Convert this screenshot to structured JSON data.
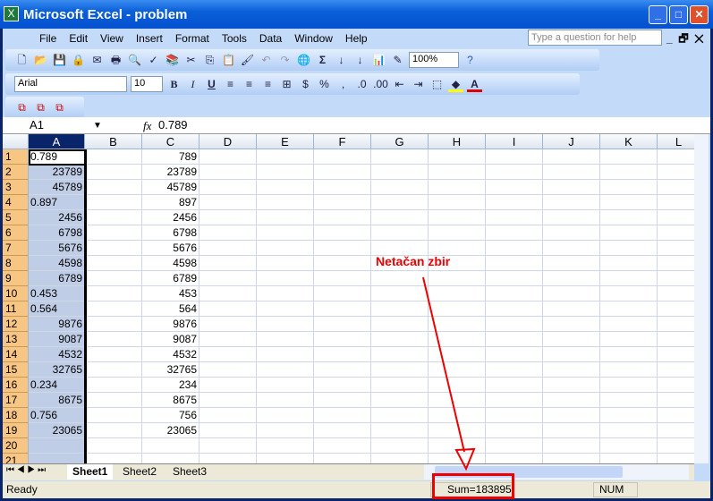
{
  "window": {
    "title": "Microsoft Excel - problem"
  },
  "menu": [
    "File",
    "Edit",
    "View",
    "Insert",
    "Format",
    "Tools",
    "Data",
    "Window",
    "Help"
  ],
  "help_placeholder": "Type a question for help",
  "toolbar": {
    "zoom": "100%",
    "font": "Arial",
    "size": "10",
    "bold": "B",
    "italic": "I",
    "underline": "U",
    "percent": "%",
    "comma": ",",
    "sum": "Σ"
  },
  "formula": {
    "name_box": "A1",
    "fx": "fx",
    "value": "0.789"
  },
  "columns": [
    "A",
    "B",
    "C",
    "D",
    "E",
    "F",
    "G",
    "H",
    "I",
    "J",
    "K",
    "L"
  ],
  "rows": [
    {
      "n": "1",
      "a": "0.789",
      "a_text": true,
      "c": "789"
    },
    {
      "n": "2",
      "a": "23789",
      "c": "23789"
    },
    {
      "n": "3",
      "a": "45789",
      "c": "45789"
    },
    {
      "n": "4",
      "a": "0.897",
      "a_text": true,
      "c": "897"
    },
    {
      "n": "5",
      "a": "2456",
      "c": "2456"
    },
    {
      "n": "6",
      "a": "6798",
      "c": "6798"
    },
    {
      "n": "7",
      "a": "5676",
      "c": "5676"
    },
    {
      "n": "8",
      "a": "4598",
      "c": "4598"
    },
    {
      "n": "9",
      "a": "6789",
      "c": "6789"
    },
    {
      "n": "10",
      "a": "0.453",
      "a_text": true,
      "c": "453"
    },
    {
      "n": "11",
      "a": "0.564",
      "a_text": true,
      "c": "564"
    },
    {
      "n": "12",
      "a": "9876",
      "c": "9876"
    },
    {
      "n": "13",
      "a": "9087",
      "c": "9087"
    },
    {
      "n": "14",
      "a": "4532",
      "c": "4532"
    },
    {
      "n": "15",
      "a": "32765",
      "c": "32765"
    },
    {
      "n": "16",
      "a": "0.234",
      "a_text": true,
      "c": "234"
    },
    {
      "n": "17",
      "a": "8675",
      "c": "8675"
    },
    {
      "n": "18",
      "a": "0.756",
      "a_text": true,
      "c": "756"
    },
    {
      "n": "19",
      "a": "23065",
      "c": "23065"
    },
    {
      "n": "20",
      "a": "",
      "c": ""
    },
    {
      "n": "21",
      "a": "",
      "c": ""
    }
  ],
  "sheets": [
    "Sheet1",
    "Sheet2",
    "Sheet3"
  ],
  "status": {
    "ready": "Ready",
    "sum": "Sum=183895",
    "num": "NUM"
  },
  "annotation": {
    "text": "Netačan zbir",
    "color": "#e00000"
  }
}
